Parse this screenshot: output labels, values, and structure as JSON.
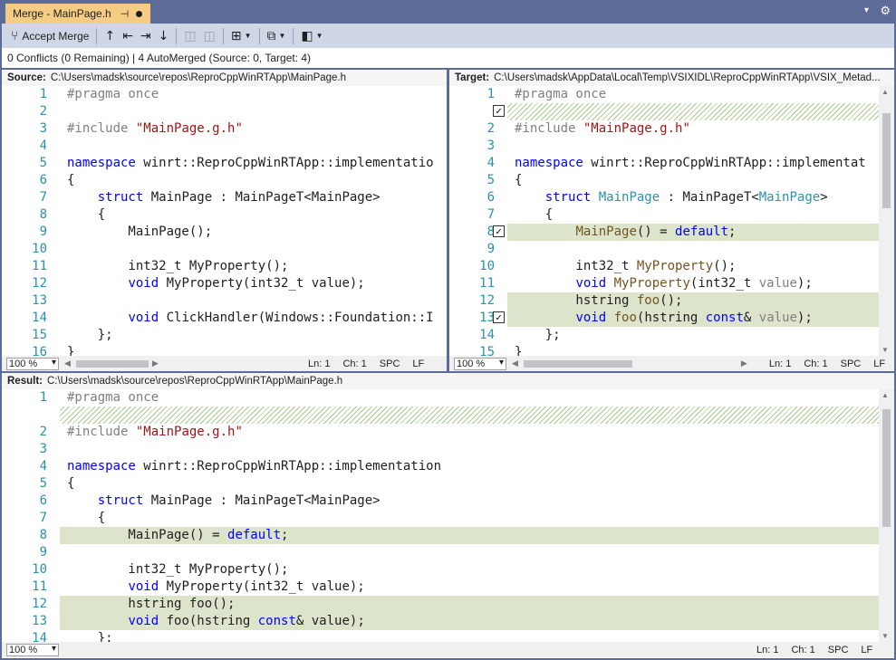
{
  "tab": {
    "title": "Merge - MainPage.h",
    "pin_icon": "pin-icon",
    "modified_icon": "dot-icon"
  },
  "toolbar": {
    "accept_merge": "Accept Merge",
    "icons": [
      "merge-icon",
      "arrow-up-icon",
      "first-change-icon",
      "last-change-icon",
      "arrow-down-icon",
      "layout-vertical-icon",
      "layout-horizontal-icon",
      "grid-icon",
      "compare-icon",
      "layout-icon"
    ]
  },
  "status": "0 Conflicts (0 Remaining) | 4 AutoMerged (Source: 0, Target: 4)",
  "source": {
    "label": "Source:",
    "path": "C:\\Users\\madsk\\source\\repos\\ReproCppWinRTApp\\MainPage.h",
    "zoom": "100 %",
    "ln": "Ln: 1",
    "ch": "Ch: 1",
    "spc": "SPC",
    "eol": "LF"
  },
  "target": {
    "label": "Target:",
    "path": "C:\\Users\\madsk\\AppData\\Local\\Temp\\VSIXIDL\\ReproCppWinRTApp\\VSIX_Metad...",
    "zoom": "100 %",
    "ln": "Ln: 1",
    "ch": "Ch: 1",
    "spc": "SPC",
    "eol": "LF"
  },
  "result": {
    "label": "Result:",
    "path": "C:\\Users\\madsk\\source\\repos\\ReproCppWinRTApp\\MainPage.h",
    "zoom": "100 %",
    "ln": "Ln: 1",
    "ch": "Ch: 1",
    "spc": "SPC",
    "eol": "LF"
  },
  "source_lines": [
    {
      "n": "1",
      "t": "#pragma once",
      "k": "pp"
    },
    {
      "n": "2",
      "t": ""
    },
    {
      "n": "3",
      "t": "#include \"MainPage.g.h\"",
      "k": "inc"
    },
    {
      "n": "4",
      "t": ""
    },
    {
      "n": "5",
      "t": "namespace winrt::ReproCppWinRTApp::implementatio",
      "k": "ns"
    },
    {
      "n": "6",
      "t": "{"
    },
    {
      "n": "7",
      "t": "    struct MainPage : MainPageT<MainPage>",
      "k": "struct"
    },
    {
      "n": "8",
      "t": "    {"
    },
    {
      "n": "9",
      "t": "        MainPage();"
    },
    {
      "n": "10",
      "t": ""
    },
    {
      "n": "11",
      "t": "        int32_t MyProperty();"
    },
    {
      "n": "12",
      "t": "        void MyProperty(int32_t value);",
      "k": "void"
    },
    {
      "n": "13",
      "t": ""
    },
    {
      "n": "14",
      "t": "        void ClickHandler(Windows::Foundation::I",
      "k": "void"
    },
    {
      "n": "15",
      "t": "    };"
    },
    {
      "n": "16",
      "t": "}"
    }
  ],
  "target_lines": [
    {
      "n": "1",
      "t": "#pragma once",
      "k": "pp"
    },
    {
      "n": "",
      "t": "",
      "hatch": true,
      "chk": "✓"
    },
    {
      "n": "2",
      "t": "#include \"MainPage.g.h\"",
      "k": "inc"
    },
    {
      "n": "3",
      "t": ""
    },
    {
      "n": "4",
      "t": "namespace winrt::ReproCppWinRTApp::implementat",
      "k": "ns"
    },
    {
      "n": "5",
      "t": "{"
    },
    {
      "n": "6",
      "t": "    struct MainPage : MainPageT<MainPage>",
      "k": "struct2"
    },
    {
      "n": "7",
      "t": "    {"
    },
    {
      "n": "8",
      "t": "        MainPage() = default;",
      "k": "def",
      "hl": true,
      "chk": "✓"
    },
    {
      "n": "9",
      "t": ""
    },
    {
      "n": "10",
      "t": "        int32_t MyProperty();",
      "k": "mp"
    },
    {
      "n": "11",
      "t": "        void MyProperty(int32_t value);",
      "k": "mp2"
    },
    {
      "n": "12",
      "t": "        hstring foo();",
      "k": "foo",
      "hl": true
    },
    {
      "n": "13",
      "t": "        void foo(hstring const& value);",
      "k": "foo2",
      "hl": true,
      "chk": "✓"
    },
    {
      "n": "14",
      "t": "    };"
    },
    {
      "n": "15",
      "t": "}"
    }
  ],
  "result_lines": [
    {
      "n": "1",
      "t": "#pragma once",
      "k": "pp"
    },
    {
      "n": "",
      "t": "",
      "hatch": true
    },
    {
      "n": "2",
      "t": "#include \"MainPage.g.h\"",
      "k": "inc"
    },
    {
      "n": "3",
      "t": ""
    },
    {
      "n": "4",
      "t": "namespace winrt::ReproCppWinRTApp::implementation",
      "k": "ns"
    },
    {
      "n": "5",
      "t": "{"
    },
    {
      "n": "6",
      "t": "    struct MainPage : MainPageT<MainPage>",
      "k": "struct"
    },
    {
      "n": "7",
      "t": "    {"
    },
    {
      "n": "8",
      "t": "        MainPage() = default;",
      "k": "defr",
      "hl": true
    },
    {
      "n": "9",
      "t": ""
    },
    {
      "n": "10",
      "t": "        int32_t MyProperty();"
    },
    {
      "n": "11",
      "t": "        void MyProperty(int32_t value);",
      "k": "void"
    },
    {
      "n": "12",
      "t": "        hstring foo();",
      "hl": true
    },
    {
      "n": "13",
      "t": "        void foo(hstring const& value);",
      "k": "foo2r",
      "hl": true
    },
    {
      "n": "14",
      "t": "    };"
    }
  ],
  "colors": {
    "accent": "#5d6b99",
    "tab": "#f5cc84",
    "toolbar": "#cfd6e5",
    "change_highlight": "#dce5cb"
  }
}
